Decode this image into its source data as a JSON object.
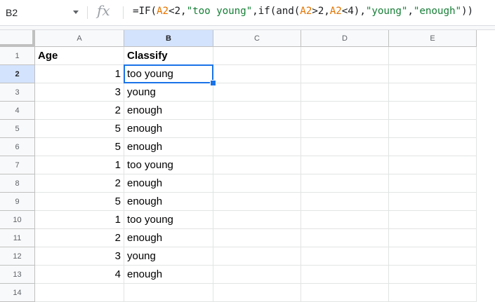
{
  "name_box": "B2",
  "formula": {
    "tokens": [
      {
        "t": "=IF(",
        "k": "plain"
      },
      {
        "t": "A2",
        "k": "ref"
      },
      {
        "t": "<2,",
        "k": "plain"
      },
      {
        "t": "\"too young\"",
        "k": "str"
      },
      {
        "t": ",if(and(",
        "k": "plain"
      },
      {
        "t": "A2",
        "k": "ref"
      },
      {
        "t": ">2,",
        "k": "plain"
      },
      {
        "t": "A2",
        "k": "ref"
      },
      {
        "t": "<4),",
        "k": "plain"
      },
      {
        "t": "\"young\"",
        "k": "str"
      },
      {
        "t": ",",
        "k": "plain"
      },
      {
        "t": "\"enough\"",
        "k": "str"
      },
      {
        "t": "))",
        "k": "plain"
      }
    ]
  },
  "columns": [
    "A",
    "B",
    "C",
    "D",
    "E"
  ],
  "selected_column": "B",
  "selected_row": "2",
  "rows": [
    {
      "n": "1",
      "a": "Age",
      "b": "Classify",
      "header": true
    },
    {
      "n": "2",
      "a": "1",
      "b": "too young"
    },
    {
      "n": "3",
      "a": "3",
      "b": "young"
    },
    {
      "n": "4",
      "a": "2",
      "b": "enough"
    },
    {
      "n": "5",
      "a": "5",
      "b": "enough"
    },
    {
      "n": "6",
      "a": "5",
      "b": "enough"
    },
    {
      "n": "7",
      "a": "1",
      "b": "too young"
    },
    {
      "n": "8",
      "a": "2",
      "b": "enough"
    },
    {
      "n": "9",
      "a": "5",
      "b": "enough"
    },
    {
      "n": "10",
      "a": "1",
      "b": "too young"
    },
    {
      "n": "11",
      "a": "2",
      "b": "enough"
    },
    {
      "n": "12",
      "a": "3",
      "b": "young"
    },
    {
      "n": "13",
      "a": "4",
      "b": "enough"
    },
    {
      "n": "14",
      "a": "",
      "b": ""
    }
  ],
  "colors": {
    "selection": "#1a73e8",
    "cell_ref": "#e37400",
    "string": "#188038"
  }
}
